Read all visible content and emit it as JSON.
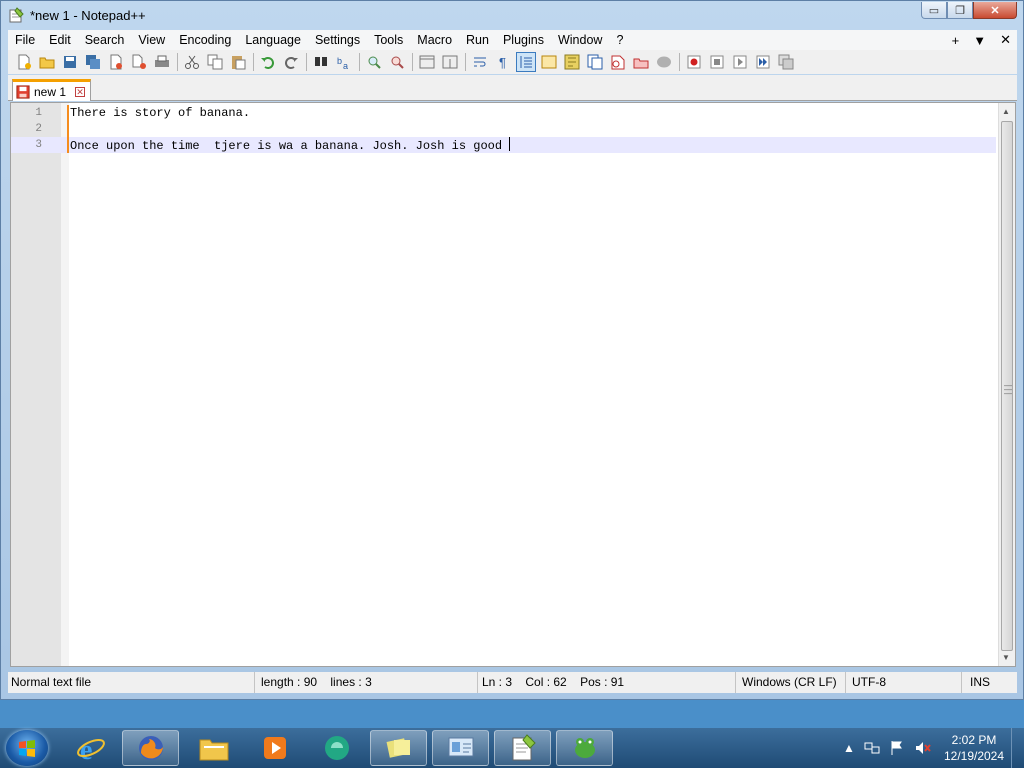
{
  "window": {
    "title": "*new 1 - Notepad++",
    "controls": {
      "minimize": "▭",
      "maximize": "❐",
      "close": "✕"
    }
  },
  "menubar": {
    "items": [
      "File",
      "Edit",
      "Search",
      "View",
      "Encoding",
      "Language",
      "Settings",
      "Tools",
      "Macro",
      "Run",
      "Plugins",
      "Window",
      "?"
    ],
    "right": {
      "add": "+",
      "dropdown": "▼",
      "close": "✕"
    }
  },
  "toolbar": {
    "icons": [
      "new-file-icon",
      "open-file-icon",
      "save-icon",
      "save-all-icon",
      "close-icon",
      "close-all-icon",
      "print-icon",
      "cut-icon",
      "copy-icon",
      "paste-icon",
      "undo-icon",
      "redo-icon",
      "find-icon",
      "replace-icon",
      "zoom-in-icon",
      "zoom-out-icon",
      "sync-vertical-icon",
      "sync-horizontal-icon",
      "word-wrap-icon",
      "show-all-chars-icon",
      "indent-guide-icon",
      "user-language-icon",
      "doc-map-icon",
      "function-list-icon",
      "folder-workspace-icon",
      "monitoring-icon",
      "record-macro-icon",
      "stop-macro-icon",
      "play-macro-icon",
      "run-macro-multiple-icon",
      "save-macro-icon"
    ]
  },
  "tab": {
    "label": "new 1",
    "close": "✕"
  },
  "editor": {
    "lines": [
      {
        "number": "1",
        "text": "There is story of banana."
      },
      {
        "number": "2",
        "text": ""
      },
      {
        "number": "3",
        "text": "Once upon the time  tjere is wa a banana. Josh. Josh is good "
      }
    ],
    "current_line": 3
  },
  "statusbar": {
    "file_type": "Normal text file",
    "length": "length : 90",
    "lines": "lines : 3",
    "ln": "Ln : 3",
    "col": "Col : 62",
    "pos": "Pos : 91",
    "eol": "Windows (CR LF)",
    "encoding": "UTF-8",
    "mode": "INS"
  },
  "taskbar": {
    "apps": [
      "internet-explorer-icon",
      "firefox-icon",
      "file-explorer-icon",
      "media-player-icon",
      "app-icon",
      "sticky-notes-icon",
      "control-panel-icon",
      "notepadpp-icon",
      "game-icon"
    ],
    "clock": {
      "time": "2:02 PM",
      "date": "12/19/2024"
    }
  },
  "colors": {
    "tab_accent": "#f5a000",
    "change_bar": "#f58c1e",
    "current_line": "#e8e8ff"
  }
}
